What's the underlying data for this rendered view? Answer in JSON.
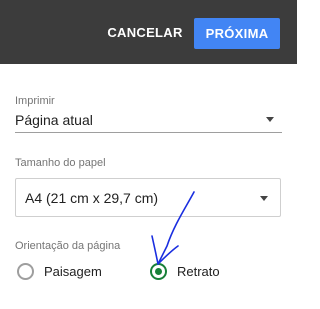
{
  "header": {
    "cancel_label": "CANCELAR",
    "next_label": "PRÓXIMA"
  },
  "print": {
    "label": "Imprimir",
    "value": "Página atual"
  },
  "paper": {
    "label": "Tamanho do papel",
    "value": "A4 (21 cm x 29,7 cm)"
  },
  "orientation": {
    "label": "Orientação da página",
    "options": [
      {
        "label": "Paisagem",
        "selected": false
      },
      {
        "label": "Retrato",
        "selected": true
      }
    ]
  },
  "colors": {
    "topbar": "#3c3c3c",
    "accent_blue": "#4285f4",
    "radio_green": "#188038",
    "annotation": "#1a2ee0"
  }
}
